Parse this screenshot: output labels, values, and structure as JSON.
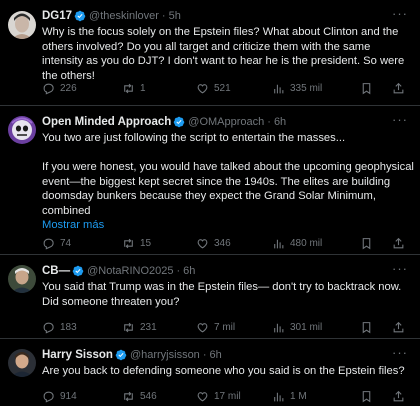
{
  "colors": {
    "background": "#000000",
    "text": "#e7e9ea",
    "muted": "#71767b",
    "accent": "#1d9bf0",
    "divider": "#2f3336"
  },
  "tweets": [
    {
      "name": "DG17",
      "handle": "@theskinlover",
      "time": "5h",
      "paragraphs": [
        "Why is the focus solely on the Epstein files? What about Clinton and the others involved? Do you all target and criticize them with the same intensity as you do DJT? I don't want to hear he is the president.  So were the others!"
      ],
      "show_more": "",
      "replies": "226",
      "retweets": "1",
      "likes": "521",
      "views": "335 mil"
    },
    {
      "name": "Open Minded Approach",
      "handle": "@OMApproach",
      "time": "6h",
      "paragraphs": [
        "You two are just following the script to entertain the masses...",
        "If you were honest, you would have talked about the upcoming geophysical event—the biggest kept secret since the 1940s. The elites are building doomsday bunkers because they expect the Grand Solar Minimum, combined"
      ],
      "show_more": "Mostrar más",
      "replies": "74",
      "retweets": "15",
      "likes": "346",
      "views": "480 mil"
    },
    {
      "name": "CB—",
      "handle": "@NotaRINO2025",
      "time": "6h",
      "paragraphs": [
        "You said that Trump was in the Epstein files— don't try to backtrack now. Did someone threaten you?"
      ],
      "show_more": "",
      "replies": "183",
      "retweets": "231",
      "likes": "7 mil",
      "views": "301 mil"
    },
    {
      "name": "Harry Sisson",
      "handle": "@harryjsisson",
      "time": "6h",
      "paragraphs": [
        "Are you back to defending someone who you said is on the Epstein files?"
      ],
      "show_more": "",
      "replies": "914",
      "retweets": "546",
      "likes": "17 mil",
      "views": "1 M"
    }
  ],
  "icons": {
    "reply": "reply-icon",
    "retweet": "retweet-icon",
    "like": "heart-icon",
    "views": "views-icon",
    "bookmark": "bookmark-icon",
    "share": "share-icon",
    "verified": "verified-badge-icon",
    "more": "more-icon"
  }
}
